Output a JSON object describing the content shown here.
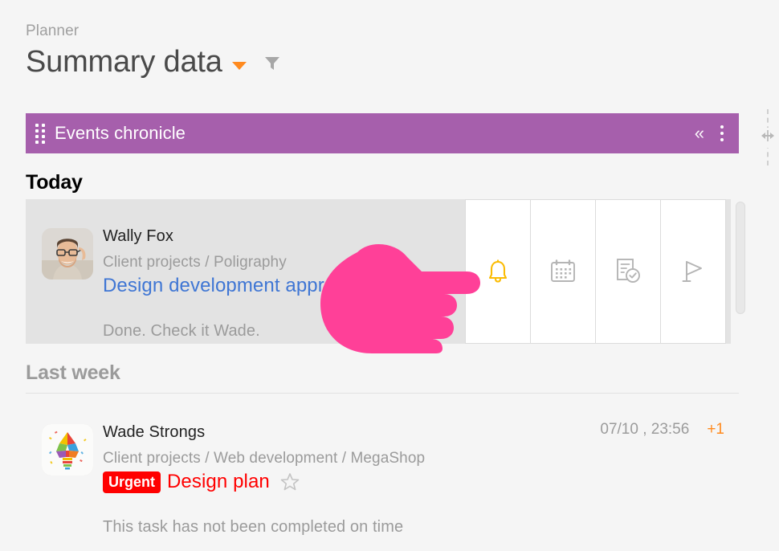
{
  "header": {
    "breadcrumb": "Planner",
    "title": "Summary data",
    "caret_icon": "caret-down-icon",
    "filter_icon": "filter-icon",
    "caret_color": "#ff8a1e",
    "filter_color": "#a0a0a0"
  },
  "widget": {
    "title": "Events chronicle",
    "bar_color": "#a65fac",
    "drag_icon": "drag-handle-icon",
    "collapse_icon": "chevron-double-left-icon",
    "collapse_glyph": "«",
    "menu_icon": "kebab-menu-icon",
    "resize_icon": "horizontal-resize-icon"
  },
  "sections": [
    {
      "id": "today",
      "label": "Today",
      "events": [
        {
          "author": "Wally Fox",
          "avatar_name": "avatar-wally-fox",
          "path": "Client projects / Poligraphy",
          "task": "Design development approval",
          "task_color": "#3f76d4",
          "note": "Done. Check it Wade.",
          "timestamp": "",
          "counter": "",
          "badge": "",
          "starred": false,
          "highlighted": true
        }
      ]
    },
    {
      "id": "lastweek",
      "label": "Last week",
      "events": [
        {
          "author": "Wade Strongs",
          "avatar_name": "avatar-wade-strongs",
          "path": "Client projects / Web development / MegaShop",
          "task": "Design plan",
          "task_color": "#ff0000",
          "note": "This task has not been completed on time",
          "timestamp": "07/10 , 23:56",
          "counter": "+1",
          "badge": "Urgent",
          "starred": true,
          "highlighted": false
        }
      ]
    }
  ],
  "actions": [
    {
      "name": "bell-icon",
      "label": "Notification",
      "color": "#fbbc05",
      "active": true
    },
    {
      "name": "calendar-icon",
      "label": "Calendar",
      "color": "#b0b0b0",
      "active": false
    },
    {
      "name": "task-check-icon",
      "label": "Task complete",
      "color": "#b0b0b0",
      "active": false
    },
    {
      "name": "flag-icon",
      "label": "Flag",
      "color": "#b0b0b0",
      "active": false
    }
  ],
  "cursor": {
    "name": "hand-pointer-cursor",
    "color": "#ff4098"
  }
}
